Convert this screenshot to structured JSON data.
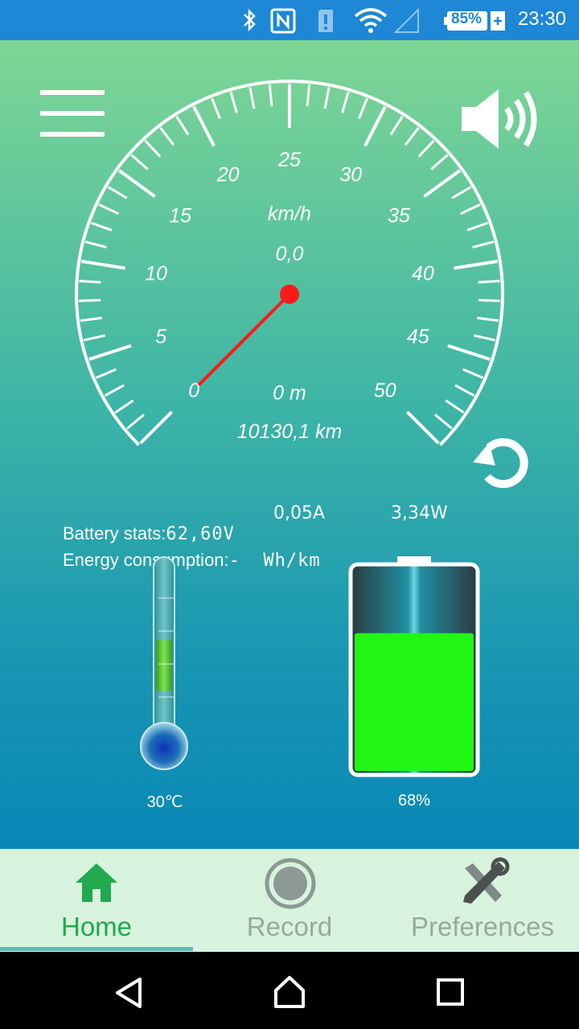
{
  "status_bar": {
    "time": "23:30",
    "battery": "85%"
  },
  "speedometer": {
    "unit": "km/h",
    "speed": "0,0",
    "tick_labels": [
      "0",
      "5",
      "10",
      "15",
      "20",
      "25",
      "30",
      "35",
      "40",
      "45",
      "50"
    ],
    "trip_distance": "0 m",
    "odometer": "10130,1 km",
    "needle_value": 0
  },
  "battery_stats": {
    "label": "Battery stats:",
    "voltage": "62,60V",
    "current": "0,05A",
    "power": "3,34W"
  },
  "energy": {
    "label": "Energy consumption:",
    "value": "-  Wh/km"
  },
  "temperature": {
    "value": "30℃",
    "level": 0.3
  },
  "battery": {
    "value": "68%",
    "level": 0.68
  },
  "tabs": [
    {
      "label": "Home",
      "active": true
    },
    {
      "label": "Record",
      "active": false
    },
    {
      "label": "Preferences",
      "active": false
    }
  ],
  "colors": {
    "accent": "#22a84e",
    "needle": "#ff1a1a",
    "battery_fill": "#22f714",
    "status_bar": "#1e88d6"
  },
  "icons": {
    "menu": "hamburger-icon",
    "sound": "speaker-icon",
    "reset": "reset-icon",
    "home": "home-icon",
    "record": "record-icon",
    "preferences": "tools-icon"
  }
}
